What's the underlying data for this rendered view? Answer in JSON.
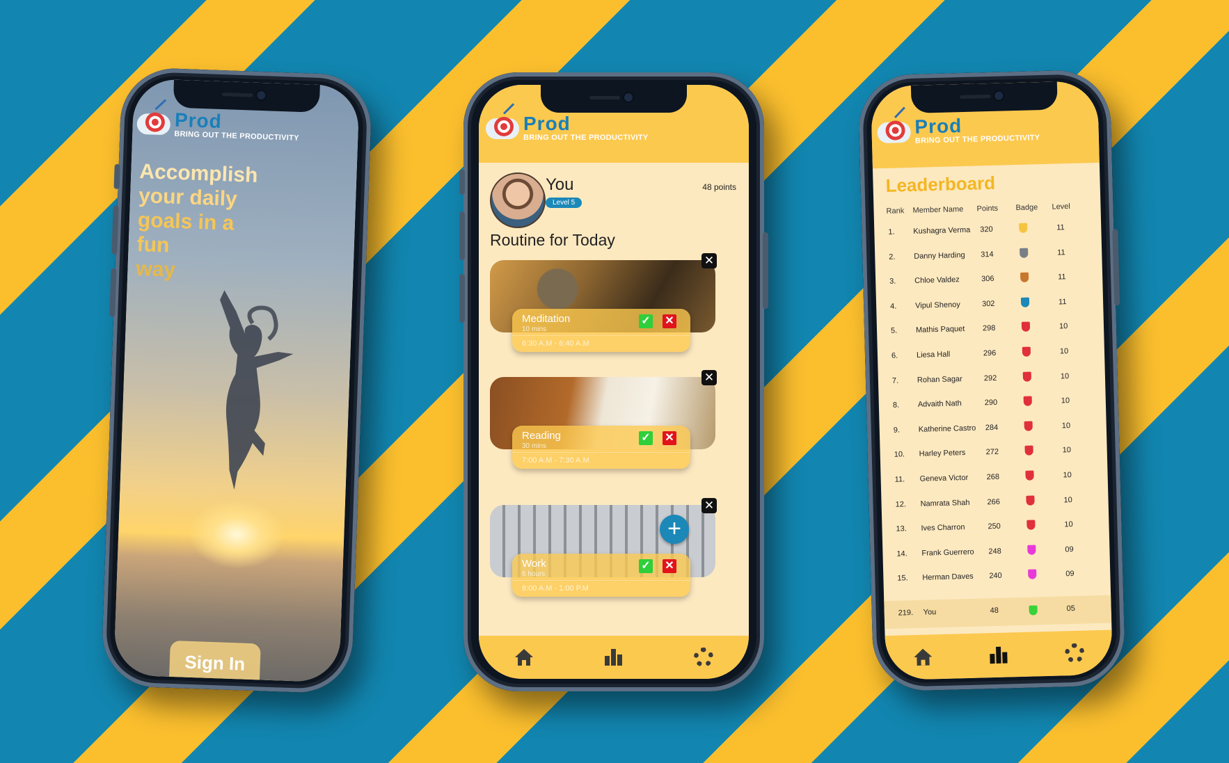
{
  "logo": {
    "name": "Prod",
    "tagline": "BRING OUT THE PRODUCTIVITY"
  },
  "signin_screen": {
    "headline": [
      "Accomplish",
      "your daily",
      "goals in a fun",
      "way"
    ],
    "signin_label": "Sign In"
  },
  "home_screen": {
    "user": {
      "name": "You",
      "level": "Level 5",
      "points": "48 points"
    },
    "routine_title": "Routine for Today",
    "tasks": [
      {
        "title": "Meditation",
        "duration": "10 mins",
        "time": "6:30 A.M - 6:40 A.M"
      },
      {
        "title": "Reading",
        "duration": "30 mins",
        "time": "7:00 A.M - 7:30 A.M"
      },
      {
        "title": "Work",
        "duration": "6 hours",
        "time": "8:00 A.M - 1:00 P.M"
      }
    ],
    "add_label": "+",
    "close_label": "✕",
    "accept_label": "✓",
    "reject_label": "✕"
  },
  "leaderboard_screen": {
    "title": "Leaderboard",
    "columns": [
      "Rank",
      "Member Name",
      "Points",
      "Badge",
      "Level"
    ],
    "rows": [
      {
        "rank": "1.",
        "name": "Kushagra Verma",
        "points": "320",
        "badge": "#f5c542",
        "level": "11"
      },
      {
        "rank": "2.",
        "name": "Danny Harding",
        "points": "314",
        "badge": "#7a7f87",
        "level": "11"
      },
      {
        "rank": "3.",
        "name": "Chloe Valdez",
        "points": "306",
        "badge": "#c7772e",
        "level": "11"
      },
      {
        "rank": "4.",
        "name": "Vipul Shenoy",
        "points": "302",
        "badge": "#1b88b8",
        "level": "11"
      },
      {
        "rank": "5.",
        "name": "Mathis Paquet",
        "points": "298",
        "badge": "#e0303b",
        "level": "10"
      },
      {
        "rank": "6.",
        "name": "Liesa Hall",
        "points": "296",
        "badge": "#e0303b",
        "level": "10"
      },
      {
        "rank": "7.",
        "name": "Rohan Sagar",
        "points": "292",
        "badge": "#e0303b",
        "level": "10"
      },
      {
        "rank": "8.",
        "name": "Advaith Nath",
        "points": "290",
        "badge": "#e0303b",
        "level": "10"
      },
      {
        "rank": "9.",
        "name": "Katherine Castro",
        "points": "284",
        "badge": "#e0303b",
        "level": "10"
      },
      {
        "rank": "10.",
        "name": "Harley Peters",
        "points": "272",
        "badge": "#e0303b",
        "level": "10"
      },
      {
        "rank": "11.",
        "name": "Geneva Victor",
        "points": "268",
        "badge": "#e0303b",
        "level": "10"
      },
      {
        "rank": "12.",
        "name": "Namrata Shah",
        "points": "266",
        "badge": "#e0303b",
        "level": "10"
      },
      {
        "rank": "13.",
        "name": "Ives Charron",
        "points": "250",
        "badge": "#e0303b",
        "level": "10"
      },
      {
        "rank": "14.",
        "name": "Frank Guerrero",
        "points": "248",
        "badge": "#e83ad8",
        "level": "09"
      },
      {
        "rank": "15.",
        "name": "Herman Daves",
        "points": "240",
        "badge": "#e83ad8",
        "level": "09"
      }
    ],
    "you_row": {
      "rank": "219.",
      "name": "You",
      "points": "48",
      "badge": "#3ad23a",
      "level": "05"
    }
  },
  "colors": {
    "brand_yellow": "#fcc94f",
    "brand_blue": "#1b88b8",
    "background_blue": "#1286b0",
    "stripe_yellow": "#fbbf2e"
  },
  "icons": [
    "home-icon",
    "leaderboard-icon",
    "settings-icon",
    "close-icon",
    "check-icon",
    "add-icon"
  ]
}
